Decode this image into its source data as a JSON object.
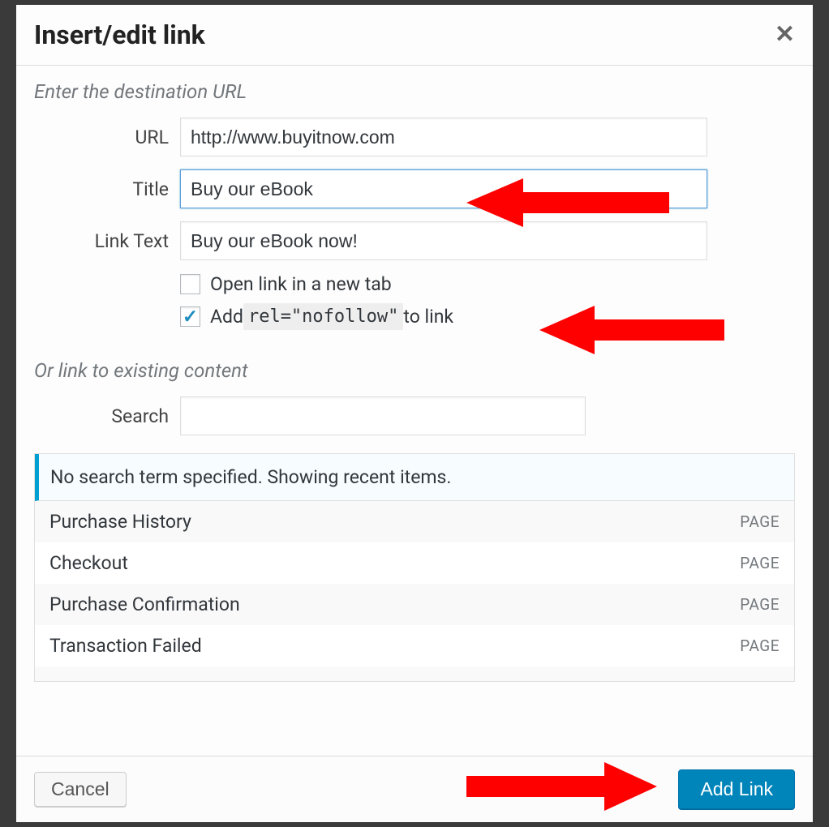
{
  "header": {
    "title": "Insert/edit link"
  },
  "form": {
    "section_label": "Enter the destination URL",
    "url_label": "URL",
    "url_value": "http://www.buyitnow.com",
    "title_label": "Title",
    "title_value": "Buy our eBook",
    "linktext_label": "Link Text",
    "linktext_value": "Buy our eBook now!",
    "newtab_label": "Open link in a new tab",
    "newtab_checked": false,
    "nofollow_prefix": "Add ",
    "nofollow_code": "rel=\"nofollow\"",
    "nofollow_suffix": " to link",
    "nofollow_checked": true
  },
  "existing": {
    "section_label": "Or link to existing content",
    "search_label": "Search",
    "search_value": "",
    "notice": "No search term specified. Showing recent items.",
    "items": [
      {
        "title": "Purchase History",
        "type": "PAGE"
      },
      {
        "title": "Checkout",
        "type": "PAGE"
      },
      {
        "title": "Purchase Confirmation",
        "type": "PAGE"
      },
      {
        "title": "Transaction Failed",
        "type": "PAGE"
      }
    ]
  },
  "footer": {
    "cancel": "Cancel",
    "submit": "Add Link"
  }
}
